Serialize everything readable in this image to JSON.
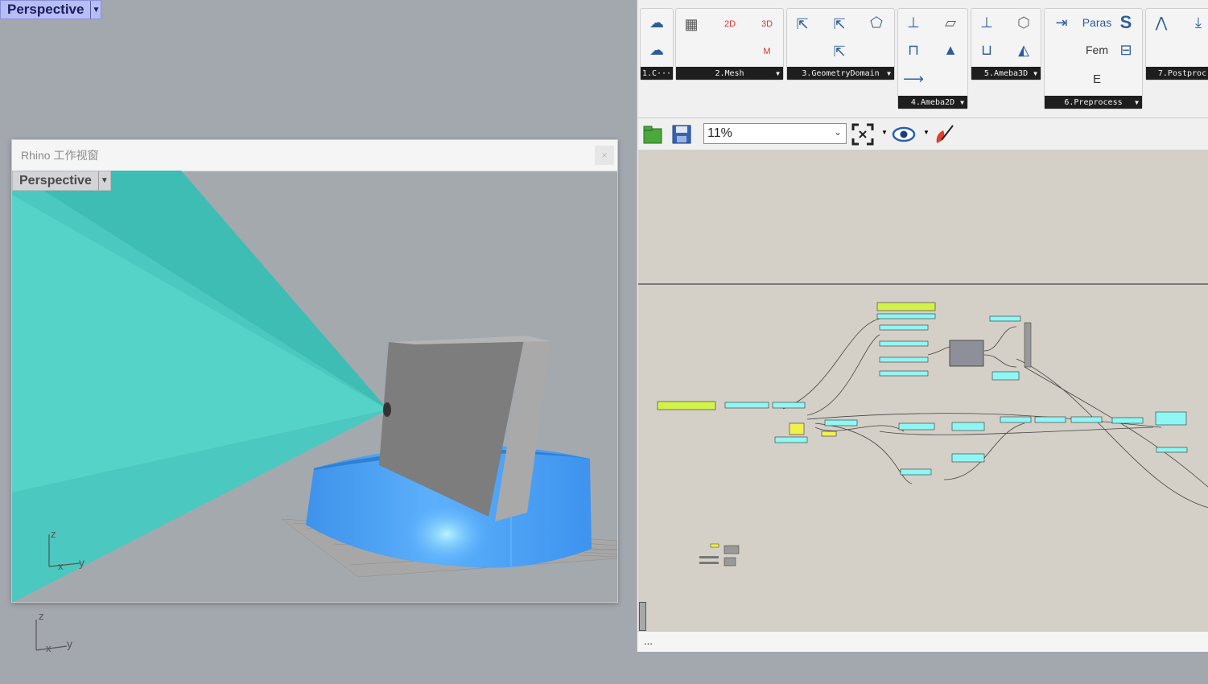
{
  "background_viewport": {
    "label": "Perspective",
    "axis_z": "z",
    "axis_x": "x",
    "axis_y": "y"
  },
  "floating_viewport": {
    "title": "Rhino 工作视窗",
    "close_icon": "×",
    "label": "Perspective",
    "axis_z": "z",
    "axis_x": "x",
    "axis_y": "y"
  },
  "grasshopper": {
    "ribbon_groups": [
      {
        "label": "1.C···"
      },
      {
        "label": "2.Mesh"
      },
      {
        "label": "3.GeometryDomain"
      },
      {
        "label": "4.Ameba2D"
      },
      {
        "label": "5.Ameba3D"
      },
      {
        "label": "6.Preprocess"
      },
      {
        "label": "7.Postproc"
      }
    ],
    "ribbon_icons": {
      "paras": "Paras",
      "fem": "Fem",
      "s": "S",
      "e": "E",
      "mesh2d": "2D",
      "mesh3d": "3D",
      "meshm": "M"
    },
    "zoom": "11%",
    "status": "..."
  },
  "colors": {
    "scene_teal": "#4fcfc3",
    "cyl_blue": "#4aa1f2",
    "node_cyan": "#8ef7f4",
    "node_lime": "#d2f24a",
    "canvas": "#d4d0c8"
  }
}
